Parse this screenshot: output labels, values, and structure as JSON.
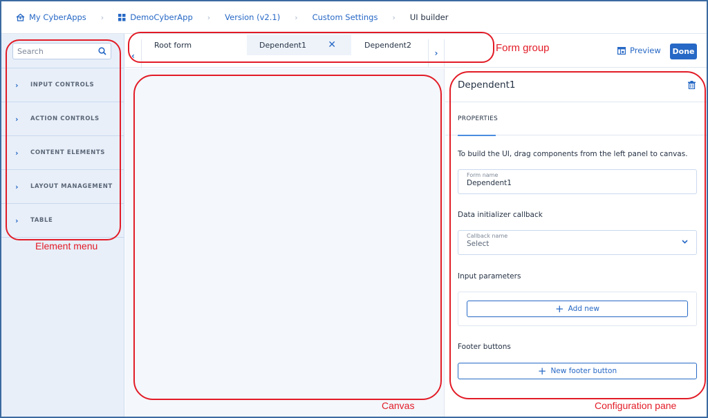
{
  "breadcrumb": {
    "items": [
      {
        "label": "My CyberApps",
        "icon": "home-icon"
      },
      {
        "label": "DemoCyberApp",
        "icon": "grid-icon"
      },
      {
        "label": "Version (v2.1)"
      },
      {
        "label": "Custom Settings"
      },
      {
        "label": "UI builder"
      }
    ],
    "separator": "›"
  },
  "sidebar": {
    "search_placeholder": "Search",
    "items": [
      {
        "label": "INPUT CONTROLS"
      },
      {
        "label": "ACTION CONTROLS"
      },
      {
        "label": "CONTENT ELEMENTS"
      },
      {
        "label": "LAYOUT MANAGEMENT"
      },
      {
        "label": "TABLE"
      }
    ]
  },
  "form_tabs": {
    "prev": "‹",
    "next": "›",
    "tabs": [
      {
        "label": "Root form"
      },
      {
        "label": "Dependent1",
        "active": true,
        "close": "✕"
      },
      {
        "label": "Dependent2"
      }
    ]
  },
  "toolbar": {
    "preview_label": "Preview",
    "done_label": "Done"
  },
  "config": {
    "title": "Dependent1",
    "tab_properties": "PROPERTIES",
    "hint": "To build the UI, drag components from the left panel to canvas.",
    "form_name": {
      "label": "Form name",
      "value": "Dependent1"
    },
    "data_init_section": "Data initializer callback",
    "callback": {
      "label": "Callback name",
      "value": "Select"
    },
    "input_params_section": "Input parameters",
    "add_new_label": "Add new",
    "footer_section": "Footer buttons",
    "new_footer_label": "New footer button"
  },
  "annotations": {
    "element_menu": "Element menu",
    "form_group": "Form group",
    "canvas": "Canvas",
    "configuration_pane": "Configuration pane"
  },
  "colors": {
    "accent": "#2668c5",
    "annotation": "#e21b26",
    "sidebar_bg": "#e8eff9",
    "canvas_bg": "#f4f7fc"
  }
}
